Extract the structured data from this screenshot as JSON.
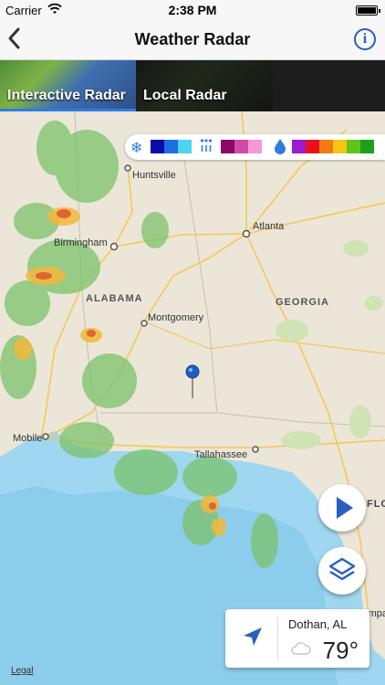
{
  "status_bar": {
    "carrier": "Carrier",
    "time": "2:38 PM"
  },
  "nav": {
    "title": "Weather Radar",
    "info_label": "i"
  },
  "tabs": [
    {
      "label": "Interactive Radar",
      "selected": true
    },
    {
      "label": "Local Radar",
      "selected": false
    }
  ],
  "legend": {
    "snow_colors": [
      "#0a0aa8",
      "#1e6fe0",
      "#4cd3f0"
    ],
    "mix_colors": [
      "#8a0a6a",
      "#d24aa8",
      "#f39ad6"
    ],
    "rain_colors": [
      "#9a1bd0",
      "#e8121e",
      "#f27a12",
      "#f6c412",
      "#62c41a",
      "#1ea01a"
    ],
    "icons": [
      "snowflake-icon",
      "mixed-precip-icon",
      "raindrop-icon"
    ]
  },
  "map": {
    "cities": [
      "Huntsville",
      "Atlanta",
      "Birmingham",
      "Montgomery",
      "Mobile",
      "Tallahassee",
      "Tampa"
    ],
    "states": [
      "ALABAMA",
      "GEORGIA",
      "FLO"
    ]
  },
  "controls": {
    "play_icon": "play-icon",
    "layers_icon": "layers-icon"
  },
  "location": {
    "name": "Dothan, AL",
    "temperature": "79°",
    "condition_icon": "cloud-icon"
  },
  "legal": "Legal"
}
